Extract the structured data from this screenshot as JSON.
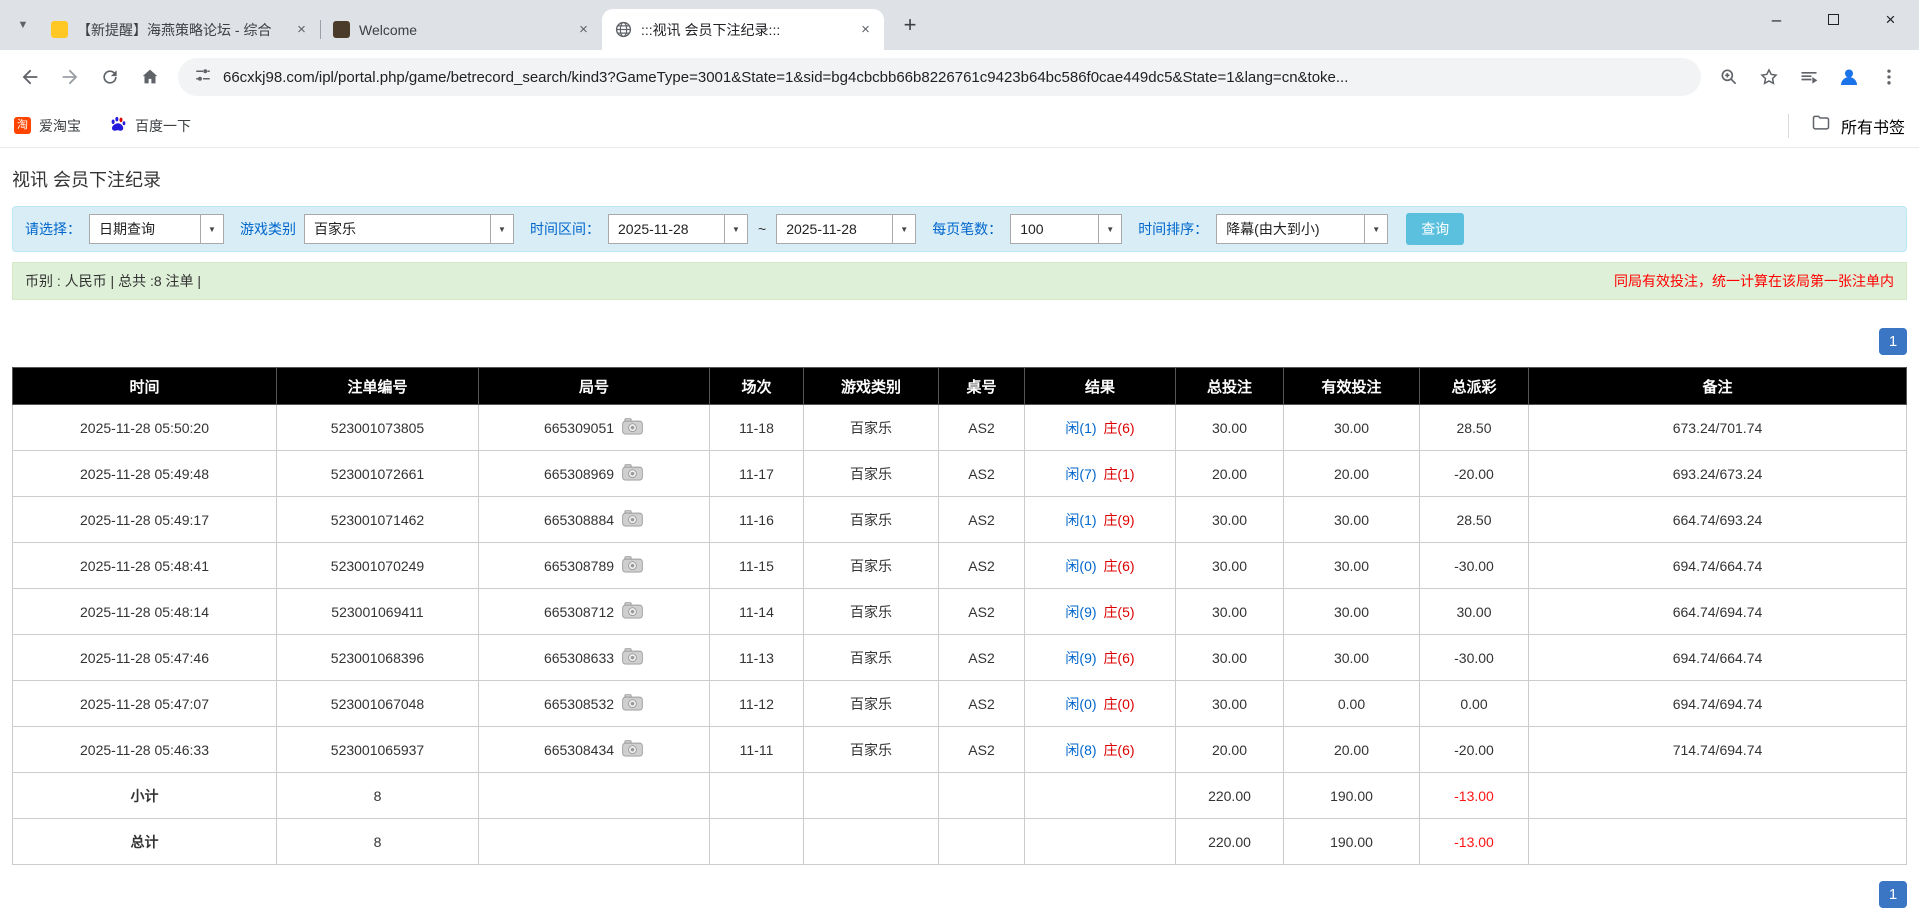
{
  "colors": {
    "tabstrip-bg": "#dee1e6",
    "accent-blue": "#0066cc",
    "link-blue": "#0066cc",
    "result-red": "#dd0000",
    "negative-red": "#ee0000",
    "pagination-blue": "#3a76c4",
    "search-btn": "#5bc0de",
    "filter-bg": "#d9edf7",
    "filter-border": "#bce8f1",
    "summary-bg": "#dff0d8",
    "summary-border": "#d6e9c6",
    "table-header-bg": "#000000",
    "row-highlight": "#ffff99",
    "footer-gray": "#9c9c9c"
  },
  "browser": {
    "tabs": [
      {
        "title": "【新提醒】海燕策略论坛 - 综合"
      },
      {
        "title": "Welcome"
      },
      {
        "title": ":::视讯 会员下注纪录:::"
      }
    ],
    "nav": {
      "url": "66cxkj98.com/ipl/portal.php/game/betrecord_search/kind3?GameType=3001&State=1&sid=bg4cbcbb66b8226761c9423b64bc586f0cae449dc5&State=1&lang=cn&toke..."
    },
    "bookmarks": {
      "items": [
        {
          "label": "爱淘宝",
          "icon_text": "淘"
        },
        {
          "label": "百度一下"
        }
      ],
      "all_bookmarks": "所有书签"
    },
    "icons": {
      "tab_search": "▼",
      "close_tab": "×",
      "new_tab": "+",
      "minimize": "–",
      "close_window": "×",
      "dropdown": "▼"
    }
  },
  "page": {
    "title": "视讯 会员下注纪录",
    "filters": {
      "select_label": "请选择：",
      "select_value": "日期查询",
      "game_type_label": "游戏类别",
      "game_type_value": "百家乐",
      "date_range_label": "时间区间：",
      "date_from": "2025-11-28",
      "date_separator": "~",
      "date_to": "2025-11-28",
      "per_page_label": "每页笔数：",
      "per_page_value": "100",
      "sort_label": "时间排序：",
      "sort_value": "降幕(由大到小)",
      "search_button": "查询"
    },
    "summary": {
      "left": "币别 : 人民币 | 总共 :8 注单 |",
      "right": "同局有效投注，统一计算在该局第一张注单内"
    },
    "pagination_top": "1",
    "pagination_bottom": "1",
    "table": {
      "headers": [
        "时间",
        "注单编号",
        "局号",
        "场次",
        "游戏类别",
        "桌号",
        "结果",
        "总投注",
        "有效投注",
        "总派彩",
        "备注"
      ],
      "rows": [
        {
          "time": "2025-11-28 05:50:20",
          "bet_id": "523001073805",
          "round_id": "665309051",
          "session": "11-18",
          "game": "百家乐",
          "table_no": "AS2",
          "result_player": "闲(1)",
          "result_banker": "庄(6)",
          "total_bet": "30.00",
          "valid_bet": "30.00",
          "payout": "28.50",
          "remark": "673.24/701.74",
          "highlight": false
        },
        {
          "time": "2025-11-28 05:49:48",
          "bet_id": "523001072661",
          "round_id": "665308969",
          "session": "11-17",
          "game": "百家乐",
          "table_no": "AS2",
          "result_player": "闲(7)",
          "result_banker": "庄(1)",
          "total_bet": "20.00",
          "valid_bet": "20.00",
          "payout": "-20.00",
          "remark": "693.24/673.24",
          "highlight": true
        },
        {
          "time": "2025-11-28 05:49:17",
          "bet_id": "523001071462",
          "round_id": "665308884",
          "session": "11-16",
          "game": "百家乐",
          "table_no": "AS2",
          "result_player": "闲(1)",
          "result_banker": "庄(9)",
          "total_bet": "30.00",
          "valid_bet": "30.00",
          "payout": "28.50",
          "remark": "664.74/693.24",
          "highlight": false
        },
        {
          "time": "2025-11-28 05:48:41",
          "bet_id": "523001070249",
          "round_id": "665308789",
          "session": "11-15",
          "game": "百家乐",
          "table_no": "AS2",
          "result_player": "闲(0)",
          "result_banker": "庄(6)",
          "total_bet": "30.00",
          "valid_bet": "30.00",
          "payout": "-30.00",
          "remark": "694.74/664.74",
          "highlight": false
        },
        {
          "time": "2025-11-28 05:48:14",
          "bet_id": "523001069411",
          "round_id": "665308712",
          "session": "11-14",
          "game": "百家乐",
          "table_no": "AS2",
          "result_player": "闲(9)",
          "result_banker": "庄(5)",
          "total_bet": "30.00",
          "valid_bet": "30.00",
          "payout": "30.00",
          "remark": "664.74/694.74",
          "highlight": false
        },
        {
          "time": "2025-11-28 05:47:46",
          "bet_id": "523001068396",
          "round_id": "665308633",
          "session": "11-13",
          "game": "百家乐",
          "table_no": "AS2",
          "result_player": "闲(9)",
          "result_banker": "庄(6)",
          "total_bet": "30.00",
          "valid_bet": "30.00",
          "payout": "-30.00",
          "remark": "694.74/664.74",
          "highlight": false
        },
        {
          "time": "2025-11-28 05:47:07",
          "bet_id": "523001067048",
          "round_id": "665308532",
          "session": "11-12",
          "game": "百家乐",
          "table_no": "AS2",
          "result_player": "闲(0)",
          "result_banker": "庄(0)",
          "total_bet": "30.00",
          "valid_bet": "0.00",
          "payout": "0.00",
          "remark": "694.74/694.74",
          "highlight": false
        },
        {
          "time": "2025-11-28 05:46:33",
          "bet_id": "523001065937",
          "round_id": "665308434",
          "session": "11-11",
          "game": "百家乐",
          "table_no": "AS2",
          "result_player": "闲(8)",
          "result_banker": "庄(6)",
          "total_bet": "20.00",
          "valid_bet": "20.00",
          "payout": "-20.00",
          "remark": "714.74/694.74",
          "highlight": false
        }
      ],
      "subtotal": {
        "label": "小计",
        "count": "8",
        "total_bet": "220.00",
        "valid_bet": "190.00",
        "payout": "-13.00"
      },
      "grand_total": {
        "label": "总计",
        "count": "8",
        "total_bet": "220.00",
        "valid_bet": "190.00",
        "payout": "-13.00"
      }
    }
  }
}
